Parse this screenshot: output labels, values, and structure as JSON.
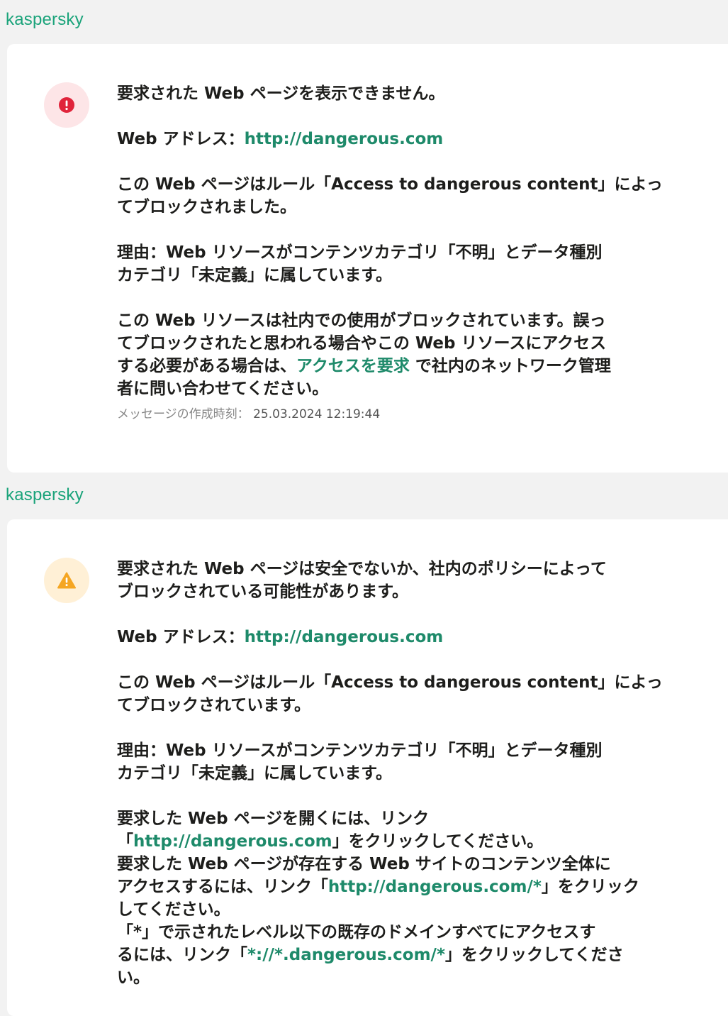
{
  "brand": "kaspersky",
  "block_card": {
    "title": "要求された Web ページを表示できません。",
    "address_label": "Web アドレス：",
    "address_url": "http://dangerous.com",
    "rule_pre": "この Web ページはルール「",
    "rule_name": "Access to dangerous content",
    "rule_post_1": "」によっ",
    "rule_post_2": "てブロックされました。",
    "reason_1": "理由：Web リソースがコンテンツカテゴリ「不明」とデータ種別",
    "reason_2": "カテゴリ「未定義」に属しています。",
    "blocked_1": "この Web リソースは社内での使用がブロックされています。誤っ",
    "blocked_2": "てブロックされたと思われる場合やこの Web リソースにアクセス",
    "blocked_3_pre": "する必要がある場合は、",
    "request_access_link": "アクセスを要求",
    "blocked_3_post": " で社内のネットワーク管理",
    "blocked_4": "者に問い合わせてください。",
    "timestamp_label": "メッセージの作成時刻：",
    "timestamp_value": "25.03.2024 12:19:44",
    "icon": "error-icon",
    "icon_color": "#e0243b"
  },
  "warn_card": {
    "title_1": "要求された Web ページは安全でないか、社内のポリシーによって",
    "title_2": "ブロックされている可能性があります。",
    "address_label": "Web アドレス：",
    "address_url": "http://dangerous.com",
    "rule_pre": "この Web ページはルール「",
    "rule_name": "Access to dangerous content",
    "rule_post_1": "」によっ",
    "rule_post_2": "てブロックされています。",
    "reason_1": "理由：Web リソースがコンテンツカテゴリ「不明」とデータ種別",
    "reason_2": "カテゴリ「未定義」に属しています。",
    "open_1": "要求した Web ページを開くには、リンク",
    "open_2_pre": "「",
    "open_link": "http://dangerous.com",
    "open_2_post": "」をクリックしてください。",
    "site_1": "要求した Web ページが存在する Web サイトのコンテンツ全体に",
    "site_2_pre": "アクセスするには、リンク「",
    "site_link": "http://dangerous.com/*",
    "site_2_post": "」をクリック",
    "site_3": "してください。",
    "domain_1": "「*」で示されたレベル以下の既存のドメインすべてにアクセスす",
    "domain_2_pre": "るには、リンク「",
    "domain_link": "*://*.dangerous.com/*",
    "domain_2_post": "」をクリックしてくださ",
    "domain_3": "い。",
    "icon": "warning-icon",
    "icon_color": "#f5a623"
  },
  "colors": {
    "brand": "#1aa37a",
    "link": "#1e8a6a"
  }
}
